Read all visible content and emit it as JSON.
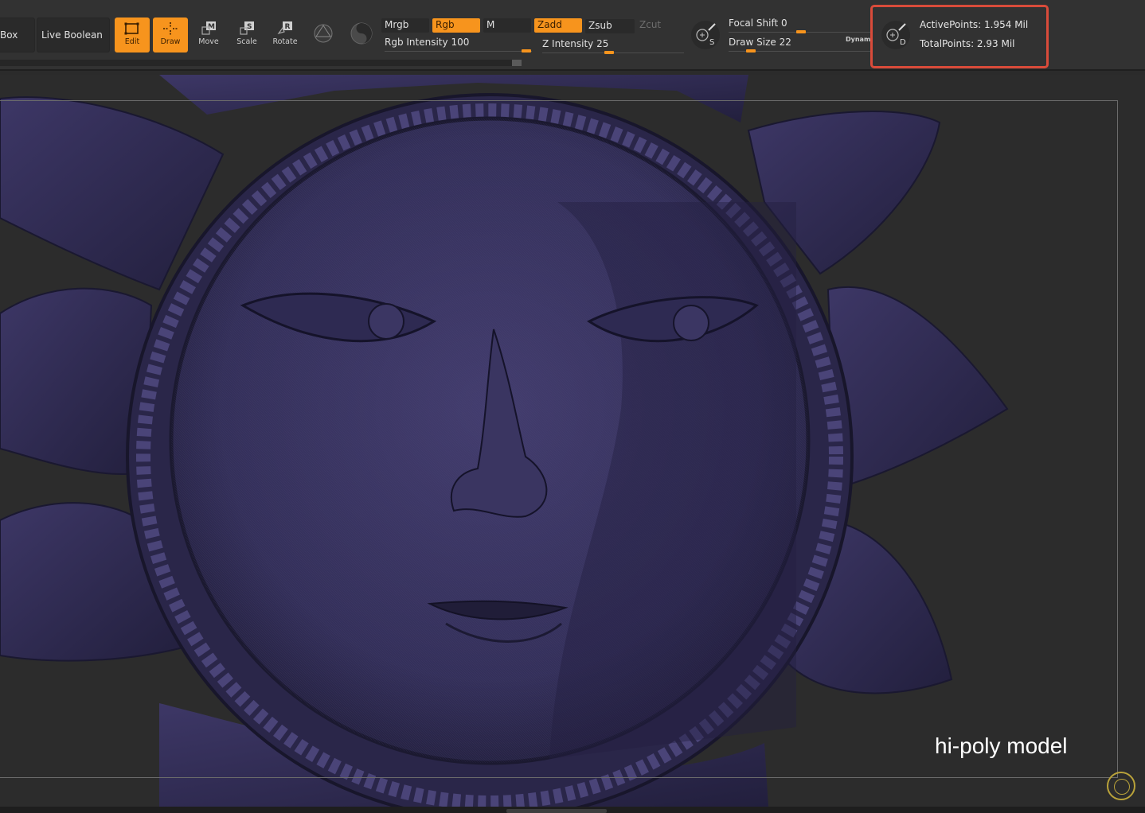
{
  "toolbar": {
    "box_label": "Box",
    "live_boolean_label": "Live Boolean",
    "tools": {
      "edit": "Edit",
      "draw": "Draw",
      "move": "Move",
      "scale": "Scale",
      "rotate": "Rotate"
    },
    "color": {
      "mrgb": "Mrgb",
      "rgb": "Rgb",
      "m": "M",
      "rgb_intensity_label": "Rgb Intensity",
      "rgb_intensity_value": "100"
    },
    "depth": {
      "zadd": "Zadd",
      "zsub": "Zsub",
      "zcut": "Zcut",
      "z_intensity_label": "Z Intensity",
      "z_intensity_value": "25"
    },
    "brush": {
      "focal_shift_label": "Focal Shift",
      "focal_shift_value": "0",
      "draw_size_label": "Draw Size",
      "draw_size_value": "22",
      "dynamic_label": "Dynamic"
    },
    "stats": {
      "active_points": "ActivePoints: 1.954 Mil",
      "total_points": "TotalPoints: 2.93 Mil"
    },
    "highlight_color": "#d94b3a",
    "accent_color": "#f7941d"
  },
  "viewport": {
    "caption": "hi-poly model",
    "model_color": "#3b3560"
  }
}
